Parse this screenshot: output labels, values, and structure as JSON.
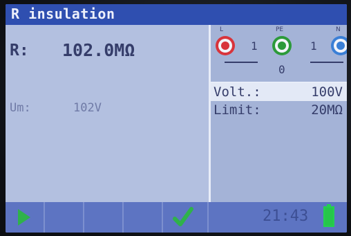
{
  "title": "R insulation",
  "measurement": {
    "r_label": "R:",
    "r_value": "102.0MΩ",
    "um_label": "Um:",
    "um_value": "102V"
  },
  "terminals": {
    "l_letter": "L",
    "pe_letter": "PE",
    "n_letter": "N",
    "l_pe_count": "1",
    "pe_n_count": "1",
    "pe_count": "0",
    "colors": {
      "l": "#d8343c",
      "pe": "#2c9a3a",
      "n": "#3a7fd6"
    }
  },
  "params": {
    "volt_label": "Volt.:",
    "volt_value": "100V",
    "limit_label": "Limit:",
    "limit_value": "20MΩ"
  },
  "status": {
    "time": "21:43"
  },
  "icons": {
    "start": "play-icon",
    "confirm": "check-icon",
    "battery": "battery-icon"
  }
}
